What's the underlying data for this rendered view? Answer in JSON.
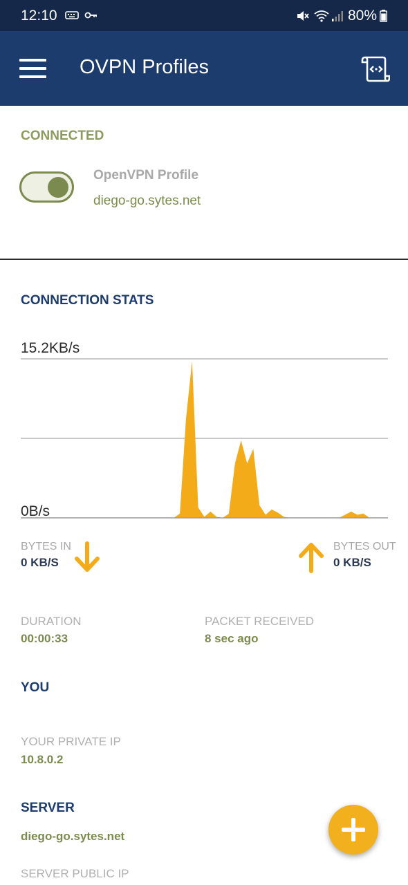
{
  "status_bar": {
    "time": "12:10",
    "battery": "80%",
    "icons": [
      "keyboard-icon",
      "key-icon",
      "mute-icon",
      "wifi-icon",
      "signal-icon",
      "battery-icon"
    ]
  },
  "app_bar": {
    "title": "OVPN Profiles",
    "menu_icon": "menu-icon",
    "import_icon": "file-import-icon"
  },
  "connection": {
    "status_label": "CONNECTED",
    "profile_name": "OpenVPN Profile",
    "host": "diego-go.sytes.net",
    "toggle_on": true
  },
  "stats": {
    "section_title": "CONNECTION STATS",
    "bytes_in_label": "BYTES IN",
    "bytes_in_value": "0 KB/S",
    "bytes_out_label": "BYTES OUT",
    "bytes_out_value": "0 KB/S"
  },
  "chart_data": {
    "type": "area",
    "top_label": "15.2KB/s",
    "bottom_label": "0B/s",
    "ylim": [
      0,
      15.2
    ],
    "color": "#f4ab19",
    "x": [
      0,
      1,
      2,
      3,
      4,
      5,
      6,
      7,
      8,
      9,
      10,
      11,
      12,
      13,
      14,
      15,
      16,
      17,
      18,
      19,
      20,
      21,
      22,
      23,
      24,
      25,
      26,
      27,
      28,
      29,
      30,
      31,
      32,
      33,
      34,
      35,
      36,
      37,
      38,
      39,
      40,
      41,
      42,
      43,
      44,
      45,
      46,
      47,
      48,
      49,
      50,
      51,
      52,
      53,
      54,
      55,
      56,
      57,
      58,
      59,
      60
    ],
    "values": [
      0,
      0,
      0,
      0,
      0,
      0,
      0,
      0,
      0,
      0,
      0,
      0,
      0,
      0,
      0,
      0,
      0,
      0,
      0,
      0,
      0,
      0,
      0,
      0,
      0,
      0,
      0.4,
      9.5,
      15.0,
      1.0,
      0.1,
      0.6,
      0.1,
      0,
      0.4,
      5.2,
      7.4,
      5.2,
      6.6,
      1.2,
      0.3,
      0.8,
      0.5,
      0.1,
      0,
      0,
      0,
      0,
      0,
      0,
      0,
      0,
      0,
      0.3,
      0.6,
      0.3,
      0.4,
      0,
      0,
      0,
      0
    ]
  },
  "session": {
    "duration_label": "DURATION",
    "duration_value": "00:00:33",
    "packet_label": "PACKET RECEIVED",
    "packet_value": "8 sec ago"
  },
  "you": {
    "section_title": "YOU",
    "private_ip_label": "YOUR PRIVATE IP",
    "private_ip_value": "10.8.0.2"
  },
  "server": {
    "section_title": "SERVER",
    "host_value": "diego-go.sytes.net",
    "public_ip_label": "SERVER PUBLIC IP"
  },
  "fab": {
    "icon": "plus-icon"
  }
}
